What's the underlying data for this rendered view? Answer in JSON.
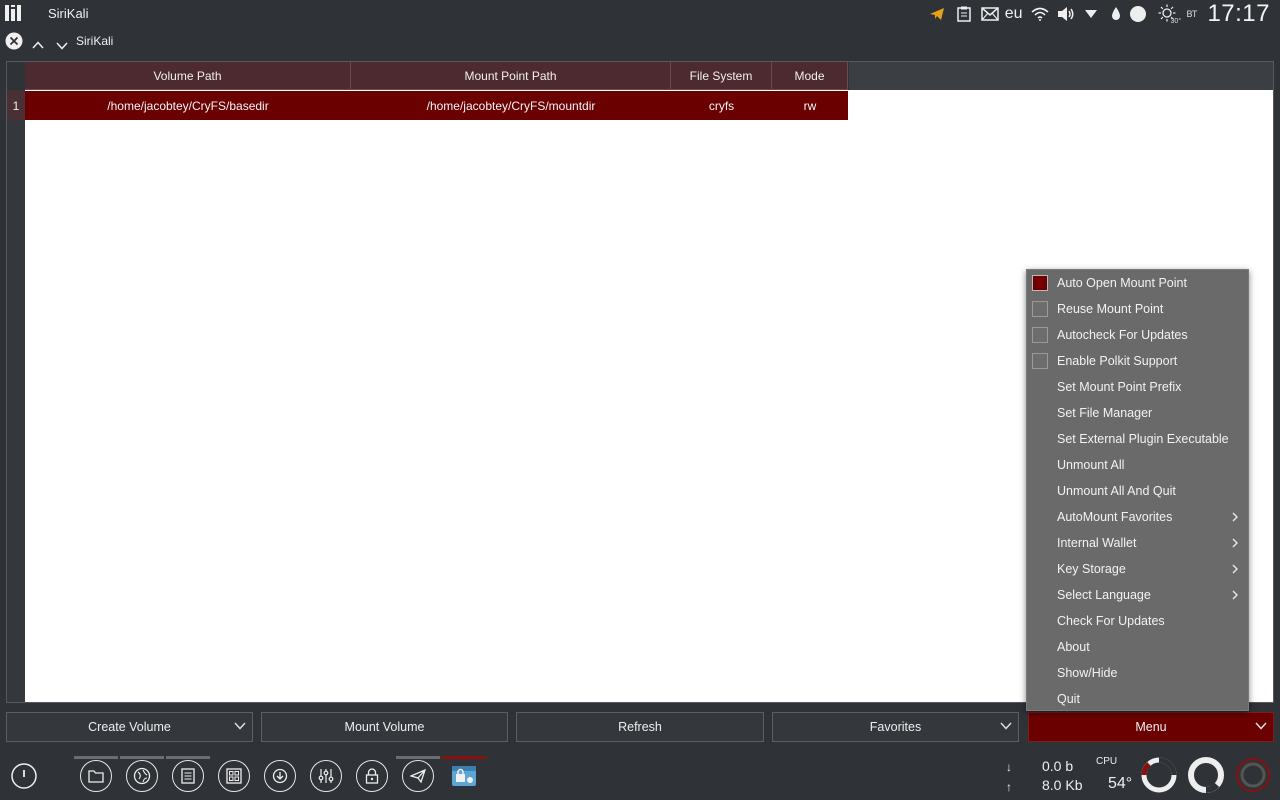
{
  "top_panel": {
    "app_name": "SiriKali",
    "keyboard_layout": "eu",
    "weather_label": "30°",
    "day": "ВТ",
    "clock": "17:17"
  },
  "window": {
    "title": "SiriKali"
  },
  "table": {
    "columns": [
      "Volume Path",
      "Mount Point Path",
      "File System",
      "Mode"
    ],
    "rows": [
      {
        "index": "1",
        "volume_path": "/home/jacobtey/CryFS/basedir",
        "mount_point_path": "/home/jacobtey/CryFS/mountdir",
        "file_system": "cryfs",
        "mode": "rw"
      }
    ]
  },
  "buttons": {
    "create_volume": "Create Volume",
    "mount_volume": "Mount Volume",
    "refresh": "Refresh",
    "favorites": "Favorites",
    "menu": "Menu"
  },
  "menu": {
    "items": [
      {
        "label": "Auto Open Mount Point",
        "checkbox": true,
        "checked": true
      },
      {
        "label": "Reuse Mount Point",
        "checkbox": true,
        "checked": false
      },
      {
        "label": "Autocheck For Updates",
        "checkbox": true,
        "checked": false
      },
      {
        "label": "Enable Polkit Support",
        "checkbox": true,
        "checked": false
      },
      {
        "label": "Set Mount Point Prefix"
      },
      {
        "label": "Set File Manager"
      },
      {
        "label": "Set External Plugin Executable"
      },
      {
        "label": "Unmount All"
      },
      {
        "label": "Unmount All And Quit"
      },
      {
        "label": "AutoMount Favorites",
        "submenu": true
      },
      {
        "label": "Internal Wallet",
        "submenu": true
      },
      {
        "label": "Key Storage",
        "submenu": true
      },
      {
        "label": "Select Language",
        "submenu": true
      },
      {
        "label": "Check For Updates"
      },
      {
        "label": "About"
      },
      {
        "label": "Show/Hide"
      },
      {
        "label": "Quit"
      }
    ]
  },
  "taskbar": {
    "net_down": "0.0 b",
    "net_up": "8.0 Kb",
    "cpu_label": "CPU",
    "cpu_temp": "54°",
    "net_down_arrow": "↓",
    "net_up_arrow": "↑"
  },
  "colors": {
    "accent": "#6b0000",
    "header": "#4d2a2f",
    "panel": "#2f3338",
    "menu_bg": "#6a6a6a"
  }
}
